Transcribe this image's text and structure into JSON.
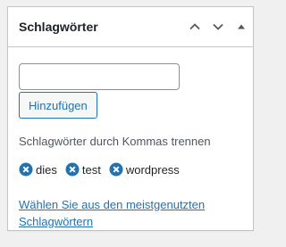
{
  "panel": {
    "title": "Schlagwörter",
    "actions": [
      {
        "icon": "chevron-up-icon"
      },
      {
        "icon": "chevron-down-icon"
      },
      {
        "icon": "triangle-up-icon"
      }
    ]
  },
  "tag_input": {
    "value": "",
    "placeholder": ""
  },
  "add_button_label": "Hinzufügen",
  "howto": "Schlagwörter durch Kommas trennen",
  "tags": [
    {
      "label": "dies"
    },
    {
      "label": "test"
    },
    {
      "label": "wordpress"
    }
  ],
  "most_used_link": "Wählen Sie aus den meistgenutzten Schlagwörtern",
  "colors": {
    "link": "#2271b1",
    "remove_icon": "#2271b1",
    "border": "#c3c4c7",
    "text": "#1d2327",
    "muted_text": "#50575e"
  }
}
